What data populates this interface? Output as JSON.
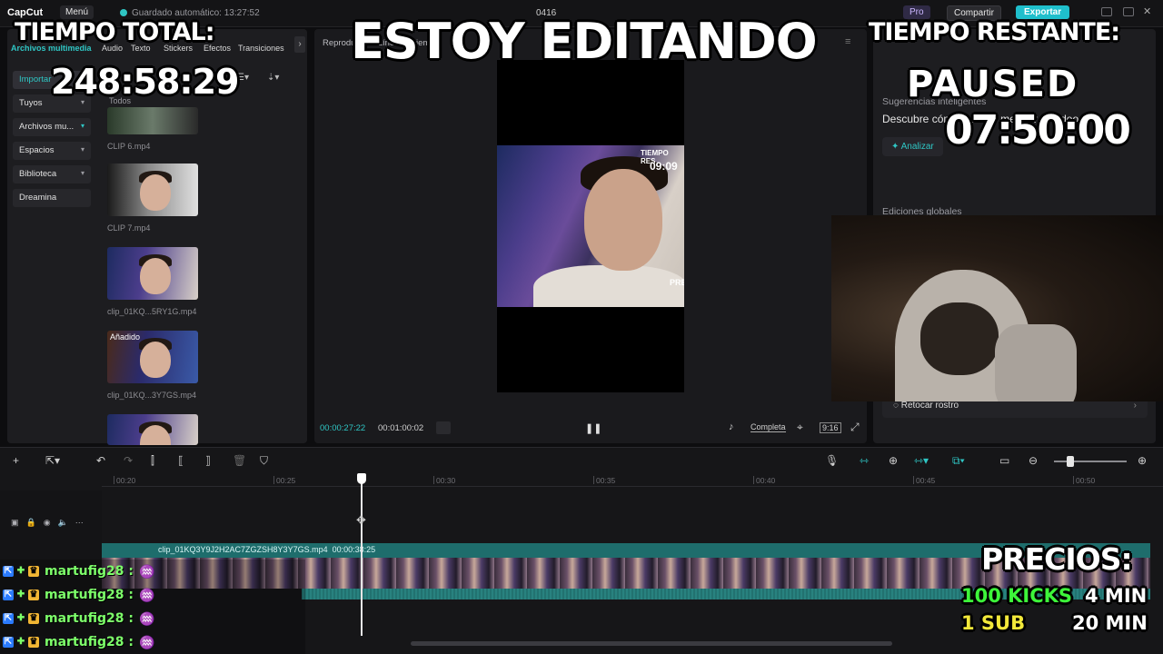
{
  "titlebar": {
    "app": "CapCut",
    "menu": "Menú",
    "autosave": "Guardado automático: 13:27:52",
    "project": "0416",
    "pro": "Pro",
    "share": "Compartir",
    "export": "Exportar"
  },
  "media_tabs": [
    {
      "label": "Archivos multimedia"
    },
    {
      "label": "Audio"
    },
    {
      "label": "Texto"
    },
    {
      "label": "Stickers"
    },
    {
      "label": "Efectos"
    },
    {
      "label": "Transiciones"
    }
  ],
  "sidenav": [
    {
      "label": "Importar"
    },
    {
      "label": "Tuyos"
    },
    {
      "label": "Archivos mu..."
    },
    {
      "label": "Espacios"
    },
    {
      "label": "Biblioteca"
    },
    {
      "label": "Dreamina"
    }
  ],
  "media_filter": "Todos",
  "media_items": [
    {
      "name": "CLIP 6.mp4",
      "badge": ""
    },
    {
      "name": "CLIP 7.mp4",
      "badge": ""
    },
    {
      "name": "clip_01KQ...5RY1G.mp4",
      "badge": ""
    },
    {
      "name": "clip_01KQ...3Y7GS.mp4",
      "badge": "Añadido"
    },
    {
      "name": "",
      "badge": ""
    }
  ],
  "player": {
    "header": "Reproductor - Línea de tiempo",
    "frame_label_1": "TIEMPO RES",
    "frame_label_2": "09:09",
    "frame_label_3": "PREC",
    "current_time": "00:00:27:22",
    "total_time": "00:01:00:02",
    "quality": "Completa",
    "ratio": "9:16"
  },
  "rightpanel": {
    "suggest_title": "Sugerencias inteligentes",
    "suggest_desc": "Descubre cómo puedes mejorar tu video",
    "analyze": "Analizar",
    "global_edits": "Ediciones globales",
    "retouch": "Retocar rostro"
  },
  "timeline": {
    "ticks": [
      "00:20",
      "00:25",
      "00:30",
      "00:35",
      "00:40",
      "00:45",
      "00:50"
    ],
    "clip_name": "clip_01KQ3Y9J2H2AC7ZGZSH8Y3Y7GS.mp4",
    "clip_duration": "00:00:38:25"
  },
  "overlay": {
    "total_label": "TIEMPO TOTAL:",
    "total_value": "248:58:29",
    "editing": "ESTOY EDITANDO",
    "remaining_label": "TIEMPO RESTANTE:",
    "paused": "PAUSED",
    "paused_time": "07:50:00",
    "prices_title": "PRECIOS:",
    "price1_item": "100 KICKS",
    "price1_value": "4 MIN",
    "price2_item": "1 SUB",
    "price2_value": "20 MIN"
  },
  "chat": [
    {
      "user": "martufig28 :"
    },
    {
      "user": "martufig28 :"
    },
    {
      "user": "martufig28 :"
    },
    {
      "user": "martufig28 :"
    }
  ],
  "colors": {
    "accent": "#2fc6c4",
    "price_green": "#3df53a",
    "price_yellow": "#f2e83a",
    "chat_name": "#7dff6a"
  }
}
